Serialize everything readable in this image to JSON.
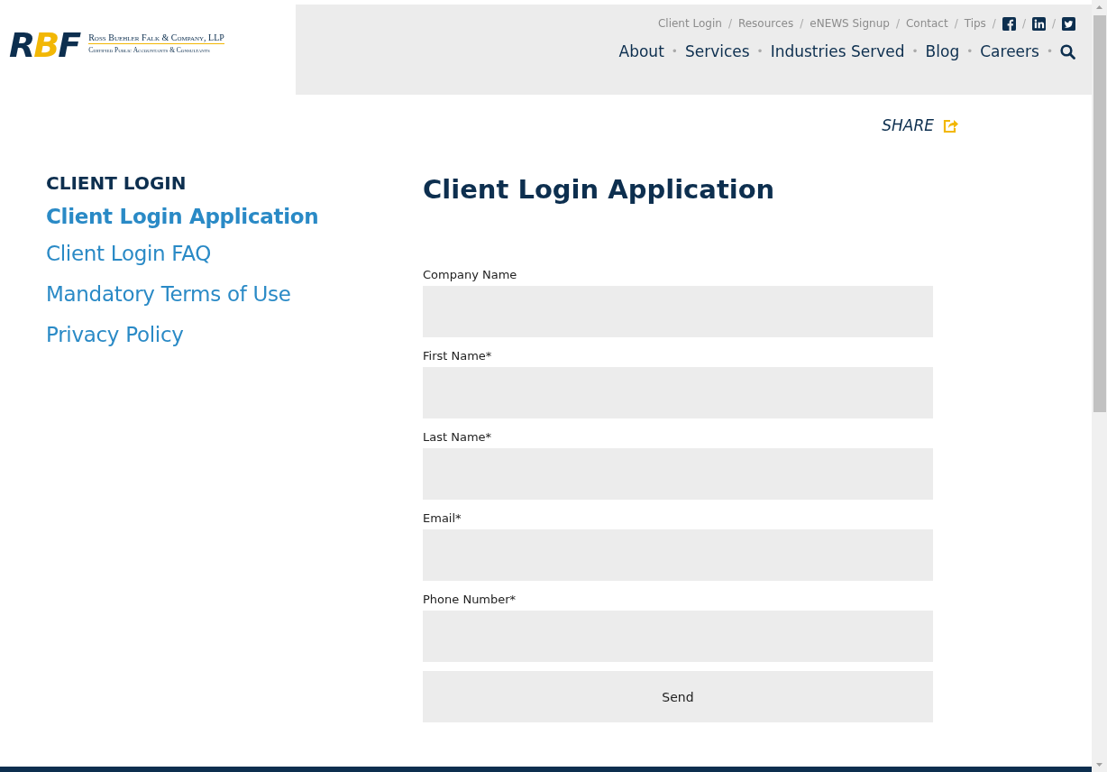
{
  "logo": {
    "mark": "RBF",
    "name": "Ross Buehler Falk & Company, LLP",
    "tagline": "Certified Public Accountants & Consultants"
  },
  "utility_separator": "/",
  "main_separator": "•",
  "utility_nav": [
    {
      "kind": "text",
      "label": "Client Login"
    },
    {
      "kind": "text",
      "label": "Resources"
    },
    {
      "kind": "text",
      "label": "eNEWS Signup"
    },
    {
      "kind": "text",
      "label": "Contact"
    },
    {
      "kind": "text",
      "label": "Tips"
    },
    {
      "kind": "facebook"
    },
    {
      "kind": "linkedin"
    },
    {
      "kind": "twitter"
    }
  ],
  "main_nav": [
    {
      "kind": "text",
      "label": "About"
    },
    {
      "kind": "text",
      "label": "Services"
    },
    {
      "kind": "text",
      "label": "Industries Served"
    },
    {
      "kind": "text",
      "label": "Blog"
    },
    {
      "kind": "text",
      "label": "Careers"
    },
    {
      "kind": "search"
    }
  ],
  "share": {
    "label": "SHARE"
  },
  "sidebar": {
    "heading": "CLIENT LOGIN",
    "items": [
      {
        "label": "Client Login Application",
        "selected": true
      },
      {
        "label": "Client Login FAQ",
        "selected": false
      },
      {
        "label": "Mandatory Terms of Use",
        "selected": false
      },
      {
        "label": "Privacy Policy",
        "selected": false
      }
    ]
  },
  "form": {
    "title": "Client Login Application",
    "fields": [
      {
        "label": "Company Name"
      },
      {
        "label": "First Name*"
      },
      {
        "label": "Last Name*"
      },
      {
        "label": "Email*"
      },
      {
        "label": "Phone Number*"
      }
    ],
    "submit": "Send"
  }
}
